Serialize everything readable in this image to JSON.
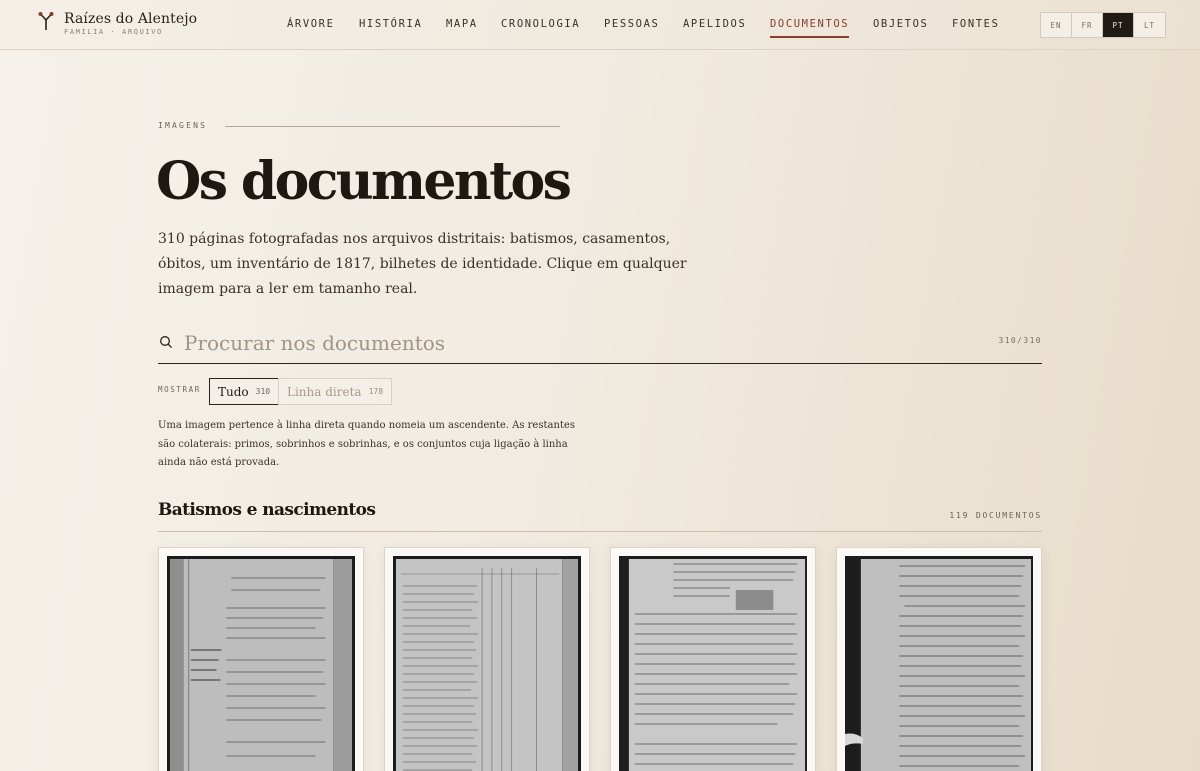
{
  "brand": {
    "title": "Raízes do Alentejo",
    "subtitle": "FAMÍLIA · ARQUIVO",
    "icon": "family-tree-icon"
  },
  "nav": {
    "items": [
      {
        "label": "ÁRVORE",
        "active": false
      },
      {
        "label": "HISTÓRIA",
        "active": false
      },
      {
        "label": "MAPA",
        "active": false
      },
      {
        "label": "CRONOLOGIA",
        "active": false
      },
      {
        "label": "PESSOAS",
        "active": false
      },
      {
        "label": "APELIDOS",
        "active": false
      },
      {
        "label": "DOCUMENTOS",
        "active": true
      },
      {
        "label": "OBJETOS",
        "active": false
      },
      {
        "label": "FONTES",
        "active": false
      }
    ],
    "active_color": "#8a3b2c"
  },
  "languages": {
    "items": [
      "EN",
      "FR",
      "PT",
      "LT"
    ],
    "selected": "PT"
  },
  "page": {
    "eyebrow": "IMAGENS",
    "title": "Os documentos",
    "intro": "310 páginas fotografadas nos arquivos distritais: batismos, casamentos, óbitos, um inventário de 1817, bilhetes de identidade. Clique em qualquer imagem para a ler em tamanho real."
  },
  "search": {
    "placeholder": "Procurar nos documentos",
    "value": "",
    "count": "310/310",
    "icon": "search-icon"
  },
  "filters": {
    "label": "MOSTRAR",
    "options": [
      {
        "label": "Tudo",
        "count": "310",
        "active": true
      },
      {
        "label": "Linha direta",
        "count": "178",
        "active": false
      }
    ],
    "note": "Uma imagem pertence à linha direta quando nomeia um ascendente. As restantes são colaterais: primos, sobrinhos e sobrinhas, e os conjuntos cuja ligação à linha ainda não está provada."
  },
  "section": {
    "title": "Batismos e nascimentos",
    "count": "119 DOCUMENTOS"
  },
  "documents": [
    {
      "kind": "register-page"
    },
    {
      "kind": "ledger-table"
    },
    {
      "kind": "handwritten-record"
    },
    {
      "kind": "handwritten-record"
    }
  ]
}
